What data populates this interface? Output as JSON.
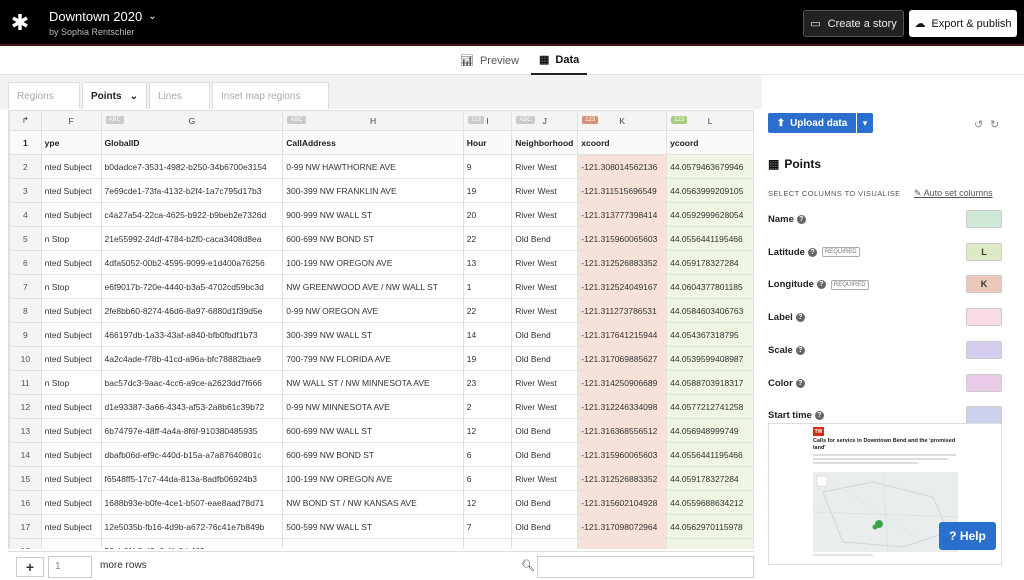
{
  "header": {
    "project_title": "Downtown 2020",
    "project_author": "by Sophia Rentschler",
    "create_story": "Create a story",
    "export_publish": "Export & publish"
  },
  "view_tabs": [
    {
      "label": "Preview",
      "icon": "bar-chart-icon",
      "active": false
    },
    {
      "label": "Data",
      "icon": "table-grid-icon",
      "active": true
    }
  ],
  "sheet_tabs": [
    {
      "label": "Regions",
      "active": false
    },
    {
      "label": "Points",
      "active": true
    },
    {
      "label": "Lines",
      "active": false
    },
    {
      "label": "Inset map regions",
      "active": false
    }
  ],
  "grid": {
    "column_letters": [
      "F",
      "G",
      "H",
      "I",
      "J",
      "K",
      "L"
    ],
    "column_types": [
      "",
      "ABC",
      "ABC",
      "123",
      "ABC",
      "123",
      "123"
    ],
    "column_names": [
      "ype",
      "GlobalID",
      "CallAddress",
      "Hour",
      "Neighborhood",
      "xcoord",
      "ycoord"
    ],
    "rows": [
      {
        "n": "1",
        "cells": null
      },
      {
        "n": "2",
        "cells": [
          "nted Subject",
          "b0dadce7-3531-4982-b250-34b6700e3154",
          "0-99 NW HAWTHORNE AVE",
          "9",
          "River West",
          "-121.308014562136",
          "44.0579463679946"
        ]
      },
      {
        "n": "3",
        "cells": [
          "nted Subject",
          "7e69cde1-73fa-4132-b2f4-1a7c795d17b3",
          "300-399 NW FRANKLIN AVE",
          "19",
          "River West",
          "-121.311515696549",
          "44.0563999209105"
        ]
      },
      {
        "n": "4",
        "cells": [
          "nted Subject",
          "c4a27a54-22ca-4625-b922-b9beb2e7326d",
          "900-999 NW WALL ST",
          "20",
          "River West",
          "-121.313777398414",
          "44.0592999628054"
        ]
      },
      {
        "n": "5",
        "cells": [
          "n Stop",
          "21e55992-24df-4784-b2f0-caca3408d8ea",
          "600-699 NW BOND ST",
          "22",
          "Old Bend",
          "-121.315960065603",
          "44.0556441195466"
        ]
      },
      {
        "n": "6",
        "cells": [
          "nted Subject",
          "4dfa5052-00b2-4595-9099-e1d400a76256",
          "100-199 NW OREGON AVE",
          "13",
          "River West",
          "-121.312526883352",
          "44.059178327284"
        ]
      },
      {
        "n": "7",
        "cells": [
          "n Stop",
          "e6f9017b-720e-4440-b3a5-4702cd59bc3d",
          "NW GREENWOOD AVE / NW WALL ST",
          "1",
          "River West",
          "-121.312524049167",
          "44.0604377801185"
        ]
      },
      {
        "n": "8",
        "cells": [
          "nted Subject",
          "2fe8bb60-8274-46d6-8a97-6880d1f39d5e",
          "0-99 NW OREGON AVE",
          "22",
          "River West",
          "-121.311273786531",
          "44.0584603406763"
        ]
      },
      {
        "n": "9",
        "cells": [
          "nted Subject",
          "466197db-1a33-43af-a840-bfb0fbdf1b73",
          "300-399 NW WALL ST",
          "14",
          "Old Bend",
          "-121.317641215944",
          "44.054367318795"
        ]
      },
      {
        "n": "10",
        "cells": [
          "nted Subject",
          "4a2c4ade-f78b-41cd-a96a-bfc78882bae9",
          "700-799 NW FLORIDA AVE",
          "19",
          "Old Bend",
          "-121.317069885627",
          "44.0539599408987"
        ]
      },
      {
        "n": "11",
        "cells": [
          "n Stop",
          "bac57dc3-9aac-4cc6-a9ce-a2623dd7f666",
          "NW WALL ST / NW MINNESOTA AVE",
          "23",
          "River West",
          "-121.314250906689",
          "44.0588703918317"
        ]
      },
      {
        "n": "12",
        "cells": [
          "nted Subject",
          "d1e93387-3a66-4343-af53-2a8b61c39b72",
          "0-99 NW MINNESOTA AVE",
          "2",
          "River West",
          "-121.312246334098",
          "44.0577212741258"
        ]
      },
      {
        "n": "13",
        "cells": [
          "nted Subject",
          "6b74797e-48ff-4a4a-8f6f-910380485935",
          "600-699 NW WALL ST",
          "12",
          "Old Bend",
          "-121.316368556512",
          "44.056948999749"
        ]
      },
      {
        "n": "14",
        "cells": [
          "nted Subject",
          "dbafb06d-ef9c-440d-b15a-a7a87640801c",
          "600-699 NW BOND ST",
          "6",
          "Old Bend",
          "-121.315960065603",
          "44.0556441195466"
        ]
      },
      {
        "n": "15",
        "cells": [
          "nted Subject",
          "f6548ff5-17c7-44da-813a-8adfb06924b3",
          "100-199 NW OREGON AVE",
          "6",
          "River West",
          "-121.312526883352",
          "44.059178327284"
        ]
      },
      {
        "n": "16",
        "cells": [
          "nted Subject",
          "1688b93e-b0fe-4ce1-b507-eae8aad78d71",
          "NW BOND ST / NW KANSAS AVE",
          "12",
          "Old Bend",
          "-121.315602104928",
          "44.0559688634212"
        ]
      },
      {
        "n": "17",
        "cells": [
          "nted Subject",
          "12e5035b-fb16-4d9b-a672-76c41e7b849b",
          "500-599 NW WALL ST",
          "7",
          "Old Bend",
          "-121.317098072964",
          "44.0562970115978"
        ]
      },
      {
        "n": "18",
        "cells": [
          "",
          "53eb61b8-d2e6-4fc6-b489-",
          "",
          "",
          "",
          "",
          ""
        ]
      }
    ]
  },
  "bottom": {
    "add_label": "+",
    "row_count": "1",
    "more_rows": "more rows"
  },
  "panel": {
    "upload_label": "Upload data",
    "title": "Points",
    "select_columns": "SELECT COLUMNS TO VISUALISE",
    "auto_set": "Auto set columns",
    "bindings": [
      {
        "label": "Name",
        "required": "",
        "value": "",
        "color": "#cfe9d6"
      },
      {
        "label": "Latitude",
        "required": "REQUIRED",
        "value": "L",
        "color": "#dcebc5"
      },
      {
        "label": "Longitude",
        "required": "REQUIRED",
        "value": "K",
        "color": "#ecc8b8"
      },
      {
        "label": "Label",
        "required": "",
        "value": "",
        "color": "#fbdde5"
      },
      {
        "label": "Scale",
        "required": "",
        "value": "",
        "color": "#d7cdef"
      },
      {
        "label": "Color",
        "required": "",
        "value": "",
        "color": "#e8cbe6"
      },
      {
        "label": "Start time",
        "required": "",
        "value": "",
        "color": "#cdd2ee"
      }
    ],
    "preview": {
      "logo": "TW",
      "title": "Calls for service in Downtown Bend and the 'promised land'"
    }
  },
  "help_label": "? Help"
}
